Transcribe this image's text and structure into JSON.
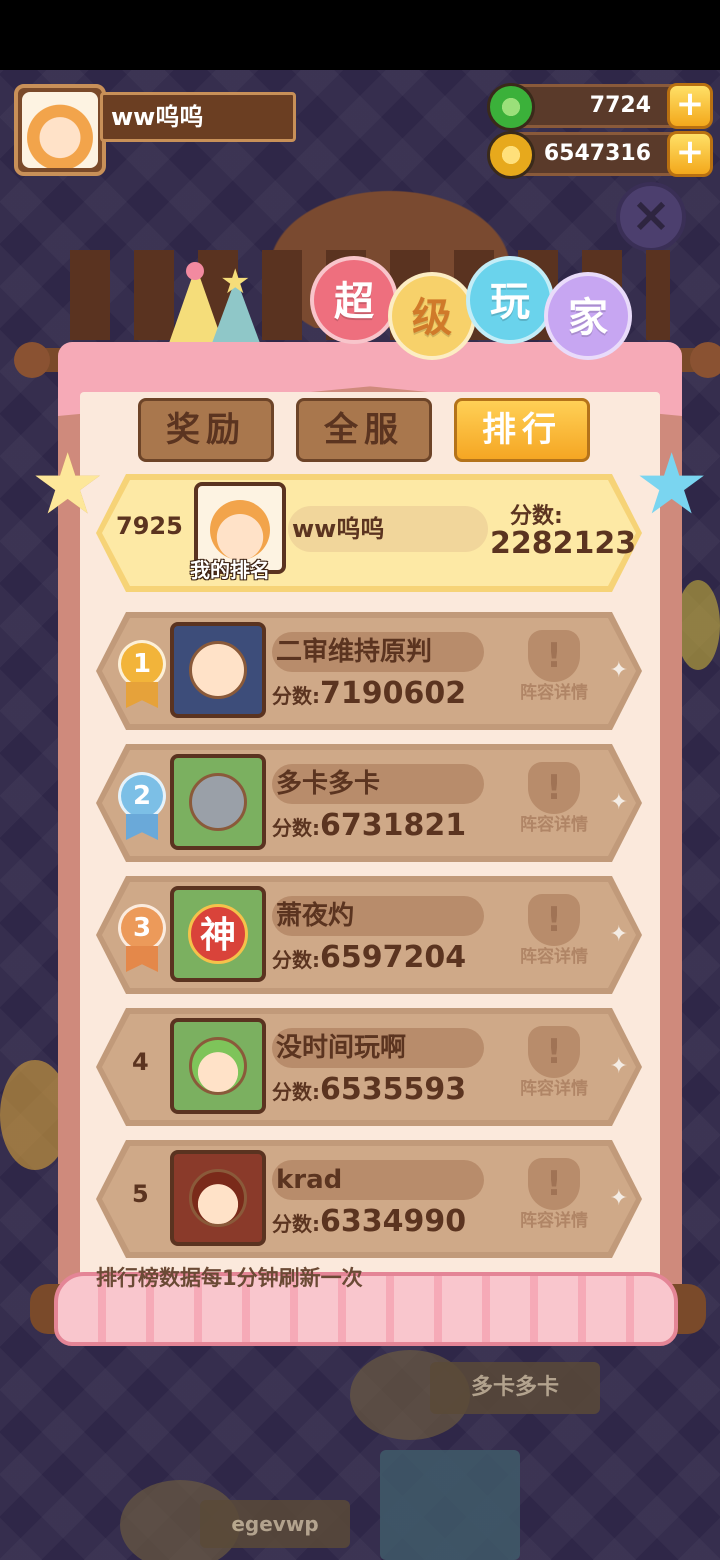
{
  "player": {
    "name": "ww呜呜"
  },
  "currency": {
    "gems": "7724",
    "coins": "6547316",
    "add_symbol": "+"
  },
  "title_chars": [
    "超",
    "级",
    "玩",
    "家"
  ],
  "tabs": [
    {
      "label": "奖励",
      "active": false
    },
    {
      "label": "全服",
      "active": false
    },
    {
      "label": "排行",
      "active": true
    }
  ],
  "my_rank": {
    "rank": "7925",
    "name": "ww呜呜",
    "avatar_label": "我的排名",
    "score_label": "分数:",
    "score": "2282123"
  },
  "leaderboard": [
    {
      "rank": "1",
      "name": "二审维持原判",
      "score_label": "分数:",
      "score": "7190602",
      "detail": "阵容详情",
      "medal": "gold"
    },
    {
      "rank": "2",
      "name": "多卡多卡",
      "score_label": "分数:",
      "score": "6731821",
      "detail": "阵容详情",
      "medal": "silver"
    },
    {
      "rank": "3",
      "name": "萧夜灼",
      "score_label": "分数:",
      "score": "6597204",
      "detail": "阵容详情",
      "medal": "bronze"
    },
    {
      "rank": "4",
      "name": "没时间玩啊",
      "score_label": "分数:",
      "score": "6535593",
      "detail": "阵容详情",
      "medal": "none"
    },
    {
      "rank": "5",
      "name": "krad",
      "score_label": "分数:",
      "score": "6334990",
      "detail": "阵容详情",
      "medal": "none"
    }
  ],
  "avatar_badge_text": "神",
  "footer_note": "排行榜数据每1分钟刷新一次",
  "background": {
    "plate_1": "多卡多卡",
    "plate_2": "egevwp"
  },
  "colors": {
    "accent_orange": "#f5a623",
    "panel_pink": "#f6aab7",
    "wood_brown": "#7a4a2a"
  }
}
